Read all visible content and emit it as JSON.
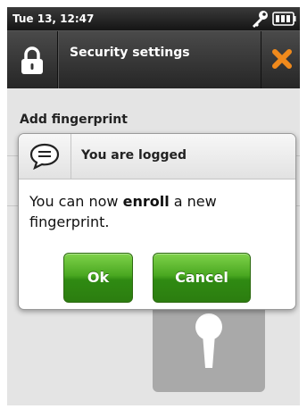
{
  "status_bar": {
    "time": "Tue 13, 12:47",
    "icons": [
      "key-icon",
      "battery-icon"
    ]
  },
  "title_bar": {
    "title": "Security settings",
    "left_icon": "lock-icon",
    "right_icon": "close-icon"
  },
  "page": {
    "section_title": "Add fingerprint",
    "tile_icon": "keyhole-icon"
  },
  "dialog": {
    "icon": "chat-icon",
    "title": "You are logged",
    "message_before": "You can now ",
    "message_bold": "enroll",
    "message_after": " a new fingerprint.",
    "ok_label": "Ok",
    "cancel_label": "Cancel"
  },
  "colors": {
    "button_green": "#3f9b1a",
    "close_orange": "#f08a1c",
    "titlebar_dark": "#2e2e2e"
  }
}
